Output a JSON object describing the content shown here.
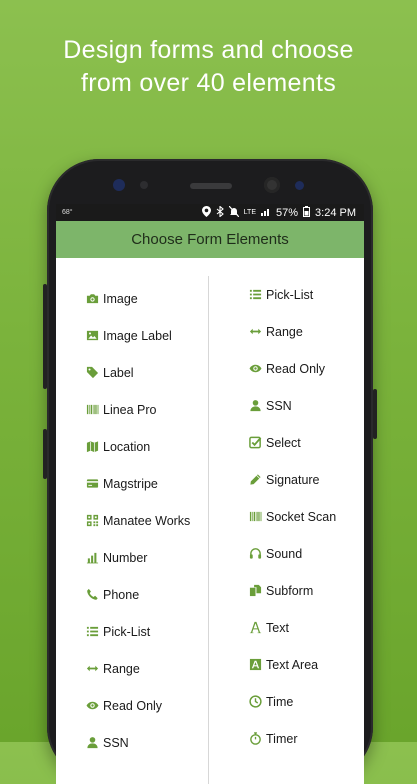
{
  "headline": {
    "line1": "Design forms and choose",
    "line2": "from over 40 elements"
  },
  "statusbar": {
    "left_text": "68°",
    "network": "LTE",
    "battery": "57%",
    "time": "3:24 PM"
  },
  "appbar": {
    "title": "Choose Form Elements"
  },
  "accent_color": "#6a9e3a",
  "left_items": [
    {
      "icon": "camera-icon",
      "label": "Image"
    },
    {
      "icon": "image-icon",
      "label": "Image Label"
    },
    {
      "icon": "tag-icon",
      "label": "Label"
    },
    {
      "icon": "barcode-icon",
      "label": "Linea Pro"
    },
    {
      "icon": "map-icon",
      "label": "Location"
    },
    {
      "icon": "credit-card-icon",
      "label": "Magstripe"
    },
    {
      "icon": "qr-code-icon",
      "label": "Manatee Works"
    },
    {
      "icon": "bar-chart-icon",
      "label": "Number"
    },
    {
      "icon": "phone-icon",
      "label": "Phone"
    },
    {
      "icon": "list-icon",
      "label": "Pick-List"
    },
    {
      "icon": "arrows-horizontal-icon",
      "label": "Range"
    },
    {
      "icon": "eye-icon",
      "label": "Read Only"
    },
    {
      "icon": "user-icon",
      "label": "SSN"
    }
  ],
  "right_items": [
    {
      "icon": "list-icon",
      "label": "Pick-List"
    },
    {
      "icon": "arrows-horizontal-icon",
      "label": "Range"
    },
    {
      "icon": "eye-icon",
      "label": "Read Only"
    },
    {
      "icon": "user-icon",
      "label": "SSN"
    },
    {
      "icon": "checkbox-icon",
      "label": "Select"
    },
    {
      "icon": "pen-icon",
      "label": "Signature"
    },
    {
      "icon": "barcode-icon",
      "label": "Socket Scan"
    },
    {
      "icon": "headset-icon",
      "label": "Sound"
    },
    {
      "icon": "copy-icon",
      "label": "Subform"
    },
    {
      "icon": "font-icon",
      "label": "Text"
    },
    {
      "icon": "font-box-icon",
      "label": "Text Area"
    },
    {
      "icon": "clock-icon",
      "label": "Time"
    },
    {
      "icon": "stopwatch-icon",
      "label": "Timer"
    }
  ]
}
